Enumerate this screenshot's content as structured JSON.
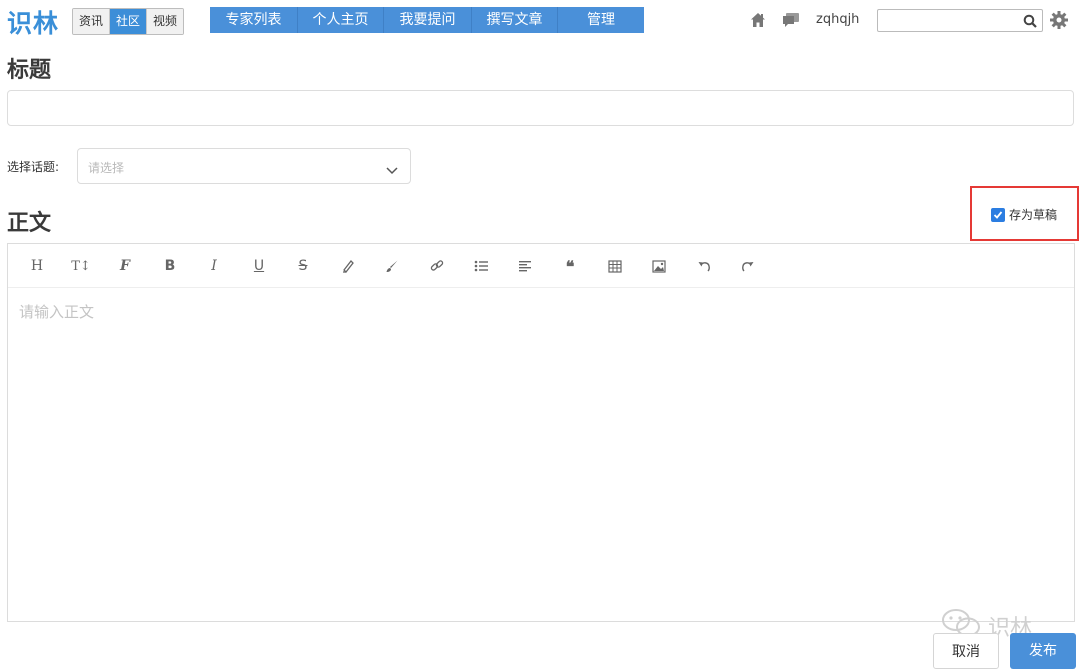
{
  "app": {
    "logo": "识林"
  },
  "segment_tabs": [
    {
      "label": "资讯",
      "active": false
    },
    {
      "label": "社区",
      "active": true
    },
    {
      "label": "视频",
      "active": false
    }
  ],
  "main_nav": [
    "专家列表",
    "个人主页",
    "我要提问",
    "撰写文章",
    "管理"
  ],
  "header": {
    "username": "zqhqjh",
    "search_placeholder": "",
    "icons": [
      "home-icon",
      "message-icon",
      "search-icon",
      "gear-icon"
    ]
  },
  "form": {
    "title_heading": "标题",
    "title_value": "",
    "topic_label": "选择话题:",
    "topic_placeholder": "请选择",
    "body_heading": "正文",
    "save_draft_label": "存为草稿",
    "save_draft_checked": true,
    "body_placeholder": "请输入正文"
  },
  "toolbar": [
    "heading-icon",
    "font-size-icon",
    "font-family-icon",
    "bold-icon",
    "italic-icon",
    "underline-icon",
    "strikethrough-icon",
    "highlight-icon",
    "brush-icon",
    "link-icon",
    "bulleted-list-icon",
    "align-icon",
    "quote-icon",
    "table-icon",
    "image-icon",
    "undo-icon",
    "redo-icon"
  ],
  "buttons": {
    "cancel": "取消",
    "publish": "发布"
  },
  "watermark": {
    "text": "识林"
  },
  "colors": {
    "accent": "#4a90d9",
    "logo": "#3a8fd8",
    "highlight_box": "#e53935"
  }
}
